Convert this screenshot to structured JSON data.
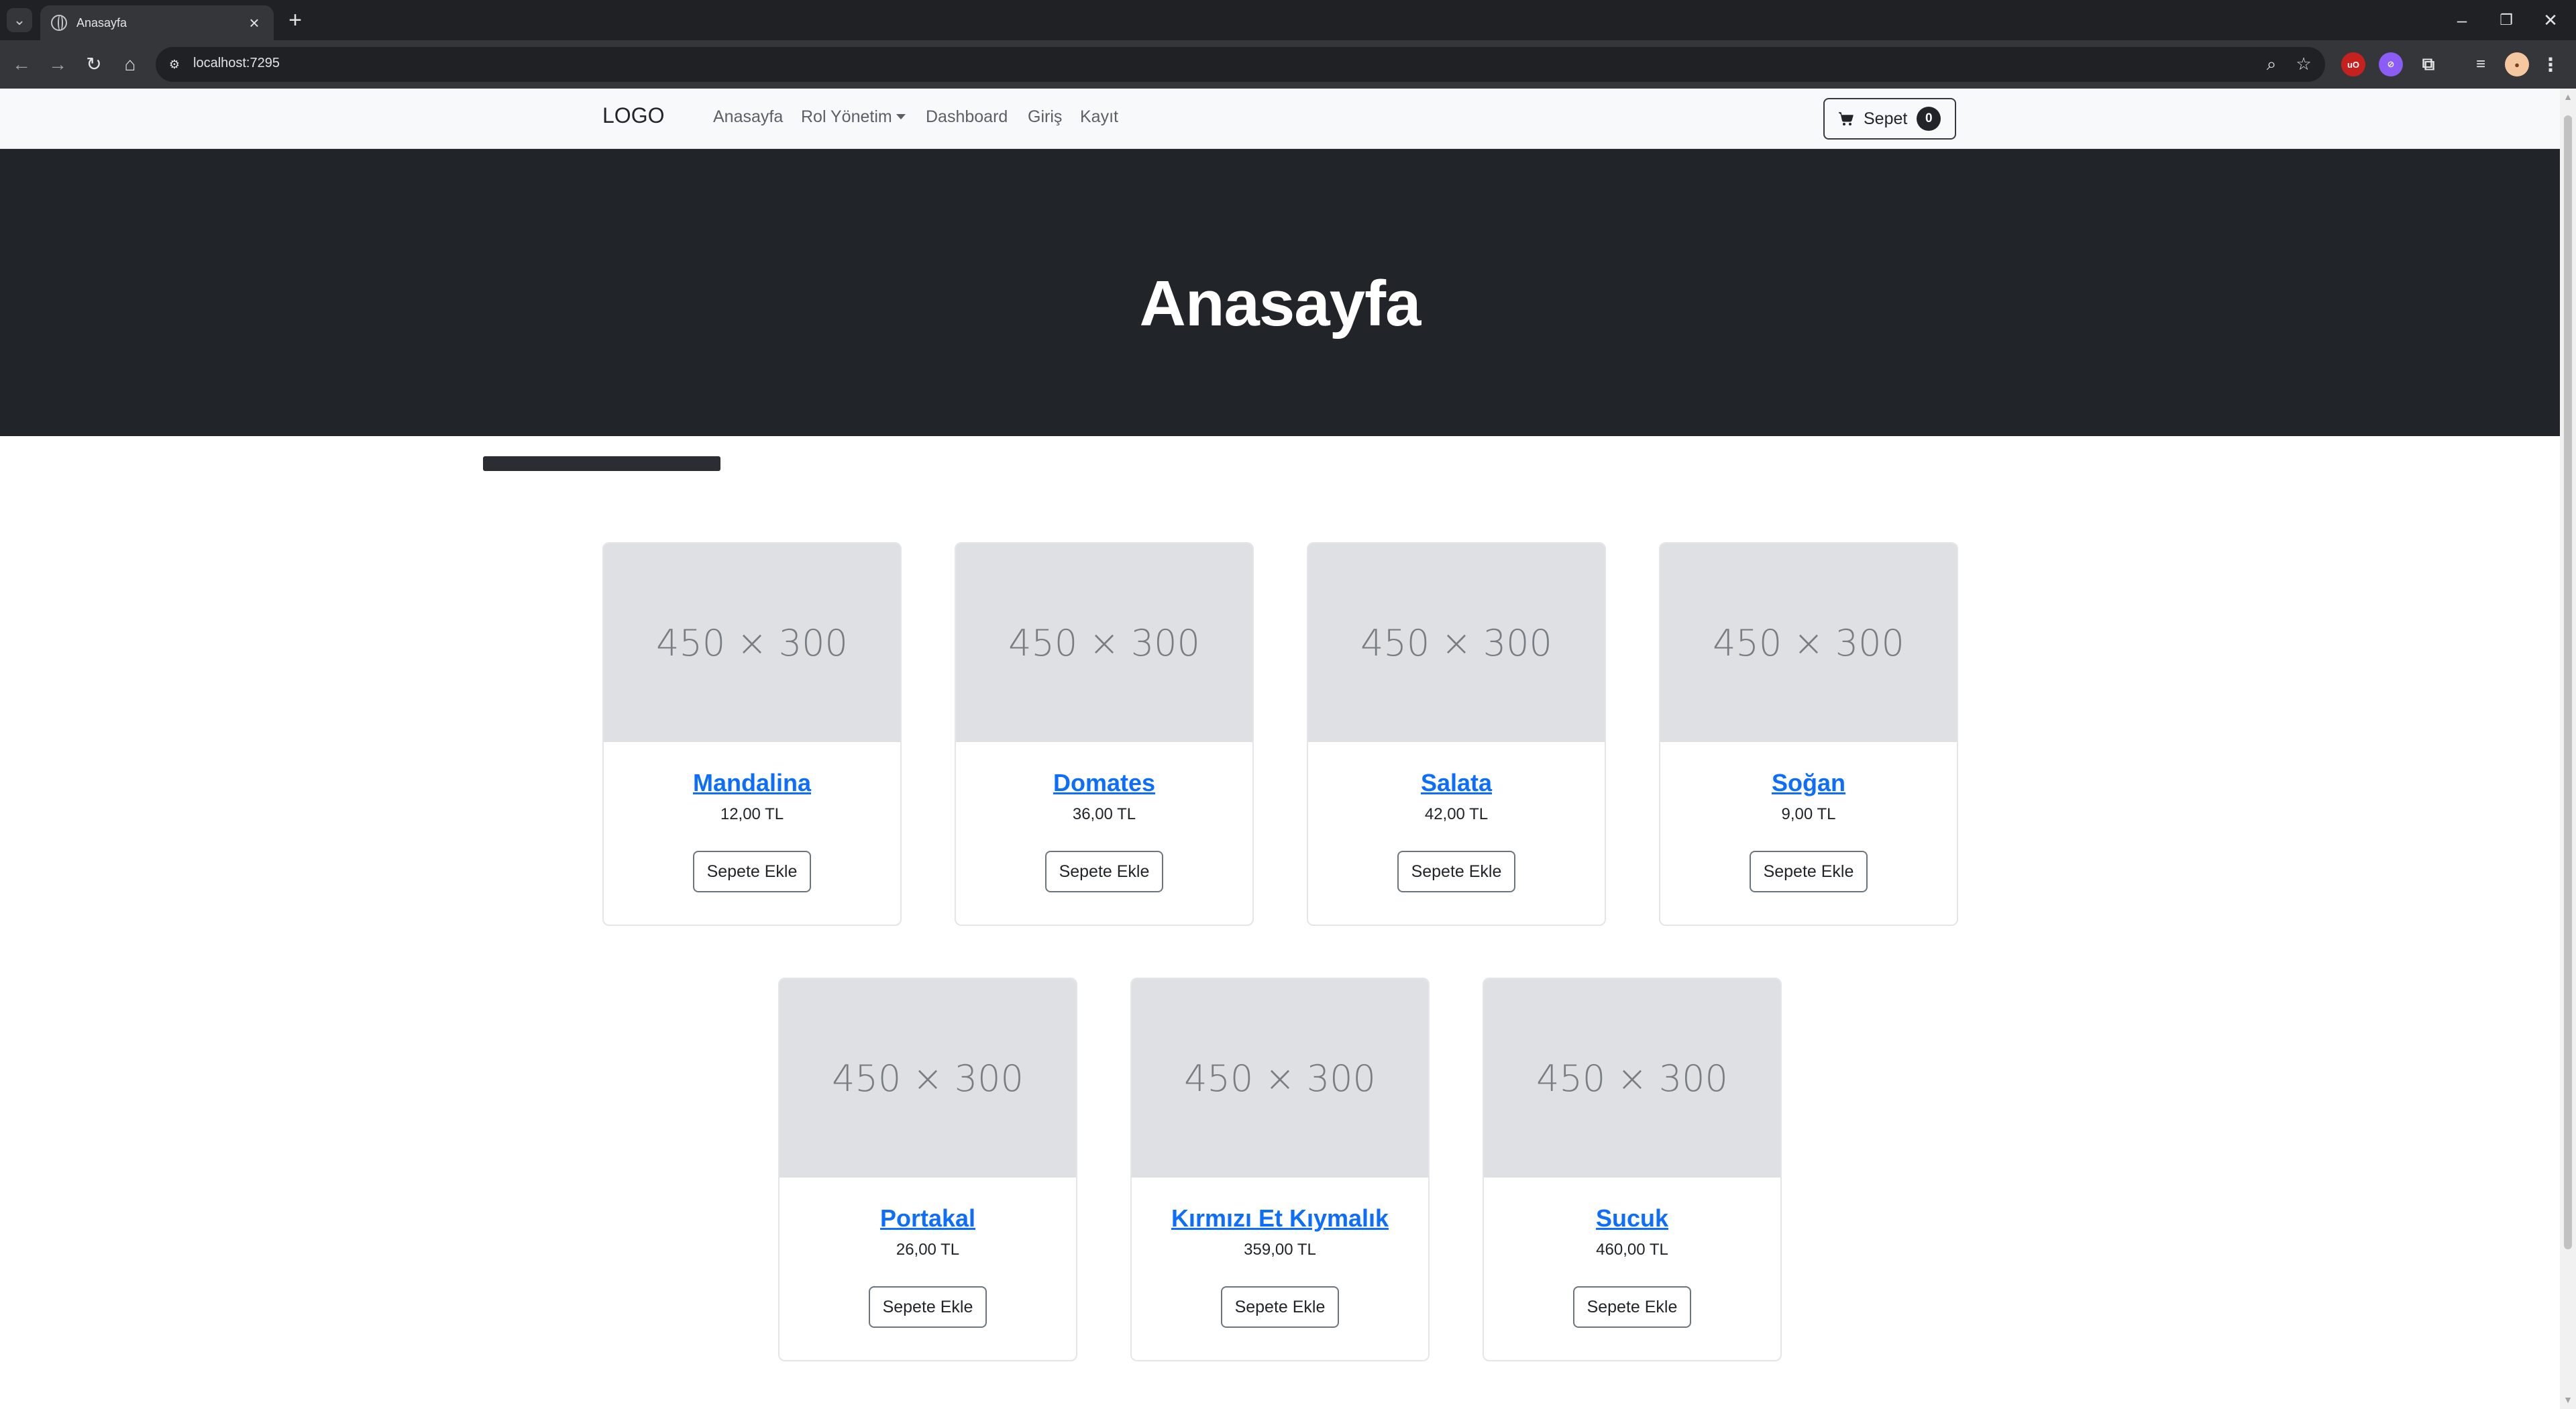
{
  "browser": {
    "tab_title": "Anasayfa",
    "url": "localhost:7295"
  },
  "site": {
    "brand": "LOGO",
    "nav": {
      "home": "Anasayfa",
      "roles": "Rol Yönetim",
      "dashboard": "Dashboard",
      "login": "Giriş",
      "register": "Kayıt"
    },
    "cart": {
      "label": "Sepet",
      "count": "0"
    }
  },
  "hero": {
    "title": "Anasayfa"
  },
  "placeholder_text": "450 × 300",
  "add_to_cart_label": "Sepete Ekle",
  "products": [
    {
      "name": "Mandalina",
      "price": "12,00 TL"
    },
    {
      "name": "Domates",
      "price": "36,00 TL"
    },
    {
      "name": "Salata",
      "price": "42,00 TL"
    },
    {
      "name": "Soğan",
      "price": "9,00 TL"
    },
    {
      "name": "Portakal",
      "price": "26,00 TL"
    },
    {
      "name": "Kırmızı Et Kıymalık",
      "price": "359,00 TL"
    },
    {
      "name": "Sucuk",
      "price": "460,00 TL"
    }
  ],
  "colors": {
    "hero_bg": "#212529",
    "link": "#0d6efd",
    "navbar_bg": "#f8f9fa"
  }
}
